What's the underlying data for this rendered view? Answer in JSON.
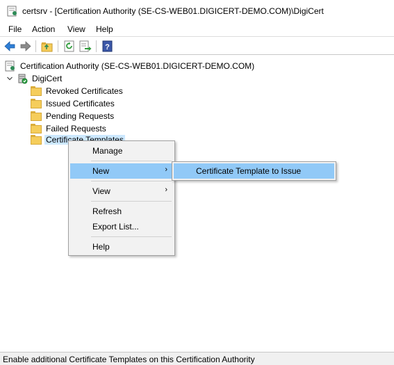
{
  "window": {
    "title": "certsrv - [Certification Authority (SE-CS-WEB01.DIGICERT-DEMO.COM)\\DigiCert"
  },
  "menubar": {
    "items": [
      "File",
      "Action",
      "View",
      "Help"
    ]
  },
  "toolbar": {
    "buttons": [
      "back-arrow-icon",
      "forward-arrow-icon",
      "up-folder-icon",
      "refresh-icon",
      "export-list-icon",
      "help-icon"
    ]
  },
  "tree": {
    "root": "Certification Authority (SE-CS-WEB01.DIGICERT-DEMO.COM)",
    "ca": "DigiCert",
    "children": [
      "Revoked Certificates",
      "Issued Certificates",
      "Pending Requests",
      "Failed Requests",
      "Certificate Templates"
    ],
    "selected": "Certificate Templates"
  },
  "context_menu": {
    "items": [
      "Manage",
      "New",
      "View",
      "Refresh",
      "Export List...",
      "Help"
    ],
    "highlighted": "New",
    "new_submenu": [
      "Certificate Template to Issue"
    ]
  },
  "status": {
    "text": "Enable additional Certificate Templates on this Certification Authority"
  },
  "colors": {
    "menu_highlight": "#91c9f7",
    "selection": "#cce8ff",
    "folder": "#f5cd5b"
  }
}
